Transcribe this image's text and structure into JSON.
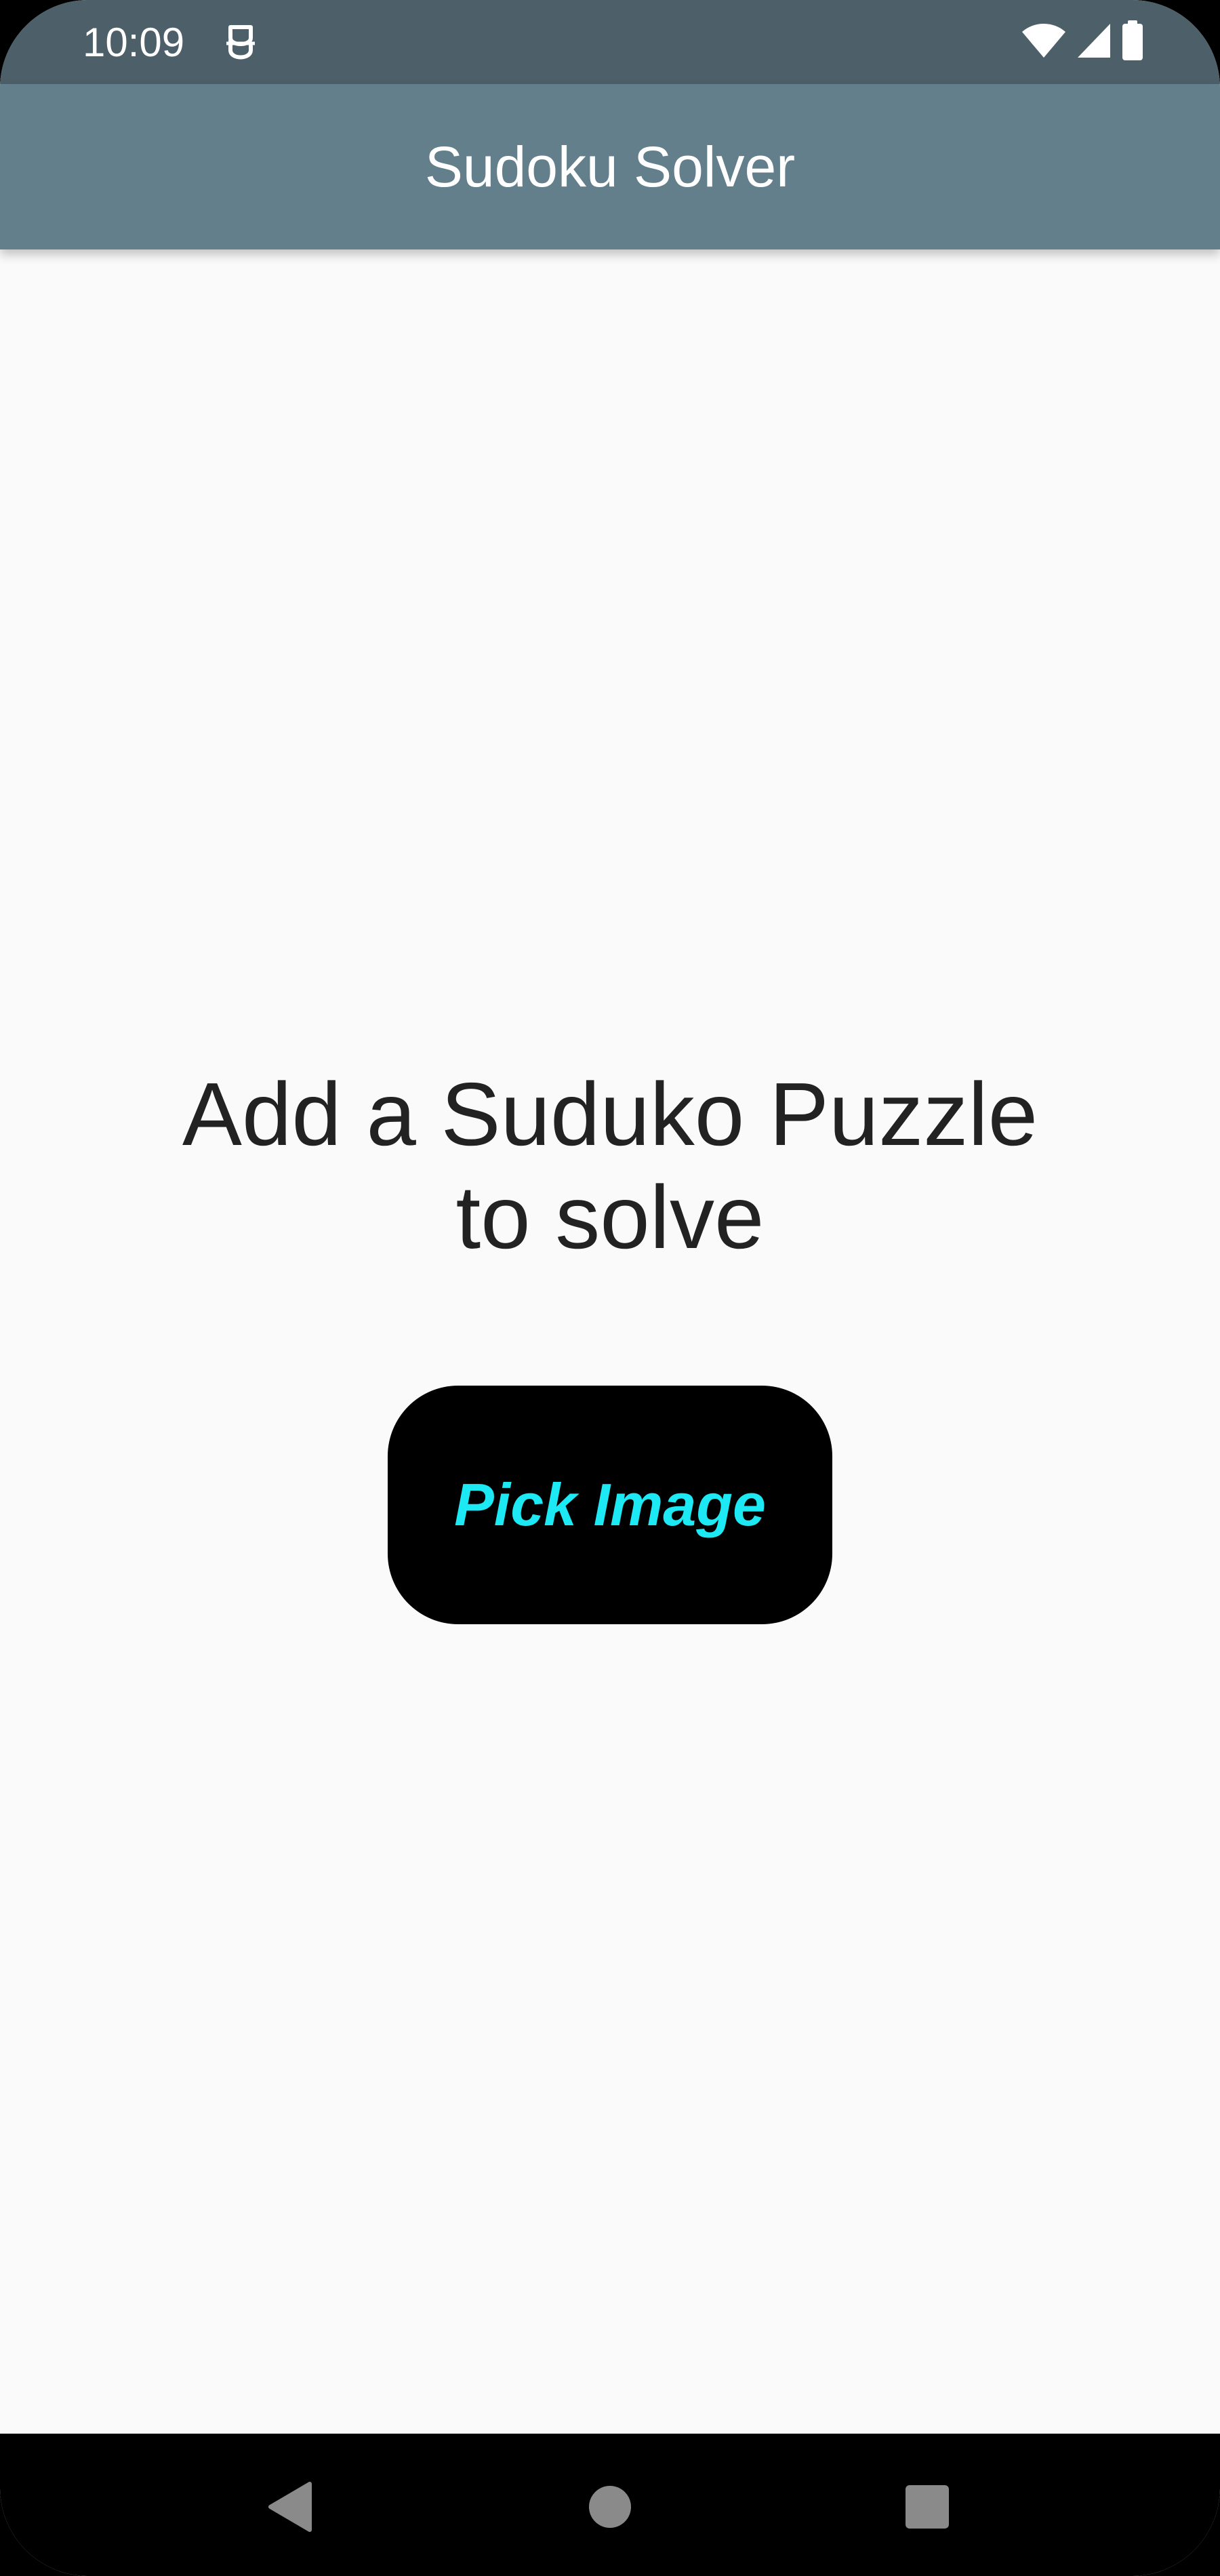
{
  "status_bar": {
    "time": "10:09",
    "icons": [
      "notification-icon",
      "wifi-icon",
      "cellular-signal-icon",
      "battery-icon"
    ]
  },
  "app_bar": {
    "title": "Sudoku Solver"
  },
  "main": {
    "prompt_line1": "Add a Suduko Puzzle",
    "prompt_line2": "to solve",
    "pick_button_label": "Pick Image"
  },
  "nav_bar": {
    "icons": [
      "back-icon",
      "home-icon",
      "recents-icon"
    ]
  },
  "colors": {
    "status_bar": "#4d5f69",
    "app_bar": "#627f8b",
    "background": "#fafafa",
    "button_bg": "#000000",
    "button_text": "#1de9f5",
    "prompt_text": "#222222"
  }
}
